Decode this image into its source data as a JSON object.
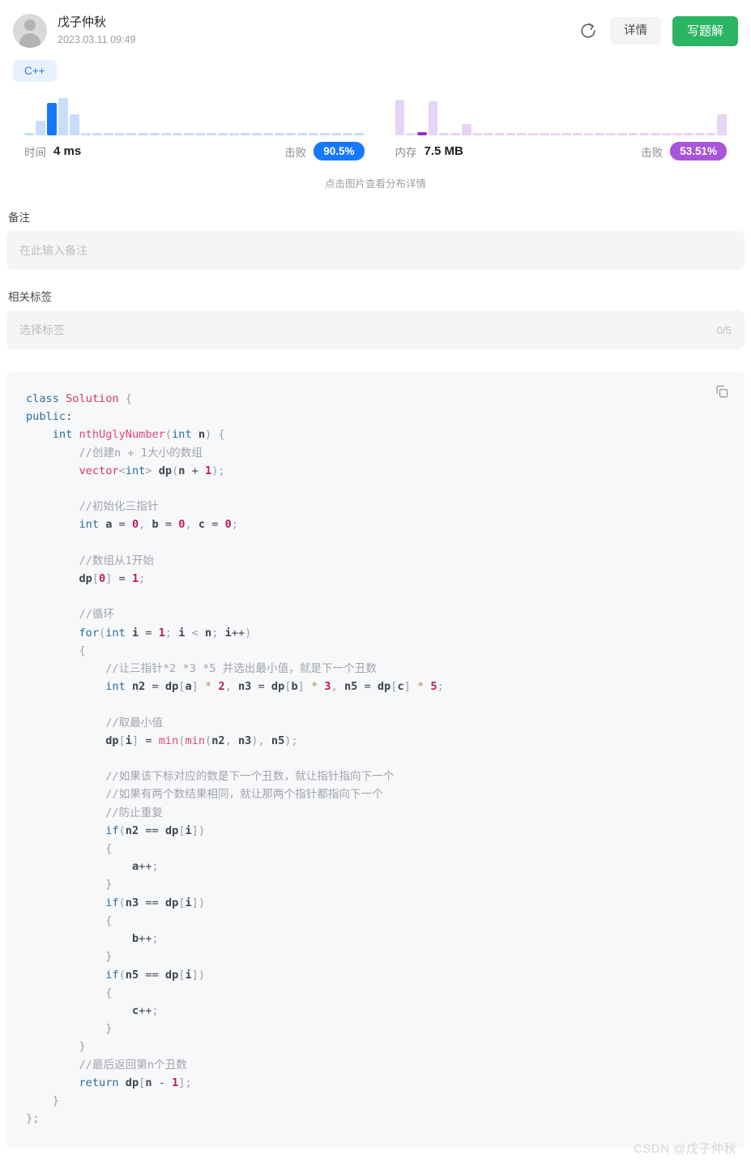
{
  "header": {
    "user_name": "戊子仲秋",
    "submit_time": "2023.03.11 09:49",
    "refresh_icon": "refresh-icon",
    "detail_button": "详情",
    "solution_button": "写题解"
  },
  "language_tag": "C++",
  "stats": {
    "hint": "点击图片查看分布详情",
    "time": {
      "key": "时间",
      "value": "4 ms",
      "beat_key": "击败",
      "beat_value": "90.5%",
      "badge_color": "#1677ff",
      "bar_color": "#c7ddfb",
      "bar_highlight_color": "#1677ff"
    },
    "memory": {
      "key": "内存",
      "value": "7.5 MB",
      "beat_key": "击败",
      "beat_value": "53.51%",
      "badge_color": "#a855d8",
      "bar_color": "#e8d4f4",
      "bar_highlight_color": "#9333c4"
    }
  },
  "chart_data": [
    {
      "type": "bar",
      "title": "时间",
      "xlabel": "",
      "ylabel": "",
      "categories": [
        "0",
        "1",
        "2",
        "3",
        "4",
        "5",
        "6",
        "7",
        "8",
        "9",
        "10",
        "11",
        "12",
        "13",
        "14",
        "15",
        "16",
        "17",
        "18",
        "19",
        "20",
        "21",
        "22",
        "23",
        "24",
        "25",
        "26",
        "27",
        "28",
        "29"
      ],
      "values": [
        0,
        18,
        40,
        46,
        26,
        2,
        2,
        2,
        2,
        2,
        2,
        2,
        2,
        2,
        2,
        2,
        2,
        2,
        2,
        2,
        2,
        2,
        2,
        2,
        2,
        2,
        2,
        2,
        2,
        2
      ],
      "highlight_index": 2,
      "ylim": [
        0,
        48
      ],
      "grid": false,
      "legend": "none"
    },
    {
      "type": "bar",
      "title": "内存",
      "xlabel": "",
      "ylabel": "",
      "categories": [
        "0",
        "1",
        "2",
        "3",
        "4",
        "5",
        "6",
        "7",
        "8",
        "9",
        "10",
        "11",
        "12",
        "13",
        "14",
        "15",
        "16",
        "17",
        "18",
        "19",
        "20",
        "21",
        "22",
        "23",
        "24",
        "25",
        "26",
        "27",
        "28",
        "29"
      ],
      "values": [
        44,
        2,
        4,
        42,
        2,
        2,
        14,
        2,
        2,
        2,
        2,
        2,
        2,
        2,
        2,
        2,
        2,
        2,
        2,
        2,
        2,
        2,
        2,
        2,
        2,
        2,
        2,
        2,
        2,
        26
      ],
      "highlight_index": 2,
      "ylim": [
        0,
        48
      ],
      "grid": false,
      "legend": "none"
    }
  ],
  "notes": {
    "label": "备注",
    "placeholder": "在此输入备注",
    "value": ""
  },
  "tags": {
    "label": "相关标签",
    "placeholder": "选择标签",
    "counter": "0/5",
    "value": ""
  },
  "code": {
    "copy_icon": "copy-icon",
    "language": "cpp",
    "lines": [
      "class Solution {",
      "public:",
      "    int nthUglyNumber(int n) {",
      "        //创建n + 1大小的数组",
      "        vector<int> dp(n + 1);",
      "",
      "        //初始化三指针",
      "        int a = 0, b = 0, c = 0;",
      "",
      "        //数组从1开始",
      "        dp[0] = 1;",
      "",
      "        //循环",
      "        for(int i = 1; i < n; i++)",
      "        {",
      "            //让三指针*2 *3 *5 并选出最小值，就是下一个丑数",
      "            int n2 = dp[a] * 2, n3 = dp[b] * 3, n5 = dp[c] * 5;",
      "",
      "            //取最小值",
      "            dp[i] = min(min(n2, n3), n5);",
      "",
      "            //如果该下标对应的数是下一个丑数，就让指针指向下一个",
      "            //如果有两个数结果相同，就让那两个指针都指向下一个",
      "            //防止重复",
      "            if(n2 == dp[i])",
      "            {",
      "                a++;",
      "            }",
      "            if(n3 == dp[i])",
      "            {",
      "                b++;",
      "            }",
      "            if(n5 == dp[i])",
      "            {",
      "                c++;",
      "            }",
      "        }",
      "        //最后返回第n个丑数",
      "        return dp[n - 1];",
      "    }",
      "};"
    ]
  },
  "watermark": "CSDN @戊子仲秋"
}
